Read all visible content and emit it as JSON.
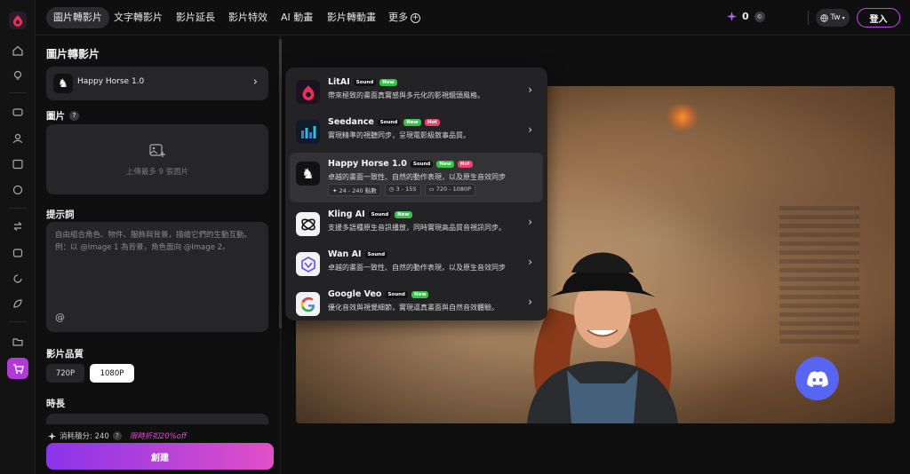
{
  "nav": {
    "tabs": [
      {
        "label": "圖片轉影片"
      },
      {
        "label": "文字轉影片"
      },
      {
        "label": "影片延長"
      },
      {
        "label": "影片特效"
      },
      {
        "label": "AI 動畫"
      },
      {
        "label": "影片轉動畫"
      },
      {
        "label": "更多"
      }
    ],
    "credits": "0",
    "lang": "Tw",
    "login": "登入"
  },
  "panel": {
    "title": "圖片轉影片",
    "model": "Happy Horse 1.0",
    "image_label": "圖片",
    "upload_text": "上傳最多 9 張圖片",
    "prompt_label": "提示詞",
    "prompt_placeholder": "自由組合角色、物件、服飾與背景，描繪它們的生動互動。例：以 @Image 1 為背景，角色面向 @Image 2。",
    "at_symbol": "@",
    "quality_label": "影片品質",
    "quality_options": [
      "720P",
      "1080P"
    ],
    "quality_selected": "1080P",
    "duration_label": "時長",
    "cost_text": "消耗積分: 240",
    "promo_text": "限時折扣20%off",
    "create_label": "創建"
  },
  "menu": {
    "items": [
      {
        "name": "LitAI",
        "badges": [
          "Sound",
          "New"
        ],
        "desc": "帶來極致的畫面真實感與多元化的影視鏡頭風格。"
      },
      {
        "name": "Seedance",
        "badges": [
          "Sound",
          "New",
          "Hot"
        ],
        "desc": "實現精準的視聽同步，呈現電影級敘事品質。"
      },
      {
        "name": "Happy Horse 1.0",
        "badges": [
          "Sound",
          "New",
          "Hot"
        ],
        "desc": "卓越的畫面一致性、自然的動作表現，以及原生音效同步",
        "chips": [
          "24 - 240 點數",
          "3 - 15S",
          "720 - 1080P"
        ]
      },
      {
        "name": "Kling AI",
        "badges": [
          "Sound",
          "New"
        ],
        "desc": "支援多語種原生音訊播放，同時實現高品質音視訊同步。"
      },
      {
        "name": "Wan AI",
        "badges": [
          "Sound"
        ],
        "desc": "卓越的畫面一致性、自然的動作表現，以及原生音效同步"
      },
      {
        "name": "Google Veo",
        "badges": [
          "Sound",
          "New"
        ],
        "desc": "優化音效與視覺細節，實現逼真畫面與自然音效體驗。"
      }
    ]
  },
  "colors": {
    "accent": "#c24ee0",
    "create_from": "#8a34ea",
    "create_to": "#e050c8",
    "discord": "#5865f2"
  }
}
